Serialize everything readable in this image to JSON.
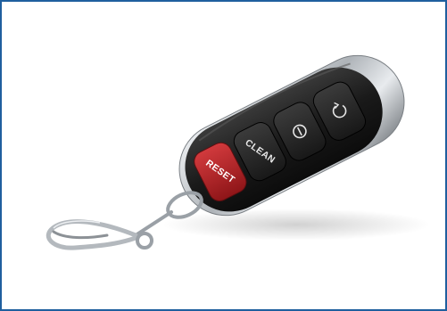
{
  "image": {
    "subject": "car-key-fob-remote",
    "colors": {
      "frame_border": "#1f5f9e",
      "body": "#1c1c1c",
      "chrome": "#c9cdd1",
      "reset_button": "#b01e22",
      "button": "#2a2a2a"
    }
  },
  "remote": {
    "buttons": {
      "reset_label": "RESET",
      "clean_label": "CLEAN",
      "power_icon": "power-icon",
      "rotate_icon": "rotate-icon"
    }
  }
}
